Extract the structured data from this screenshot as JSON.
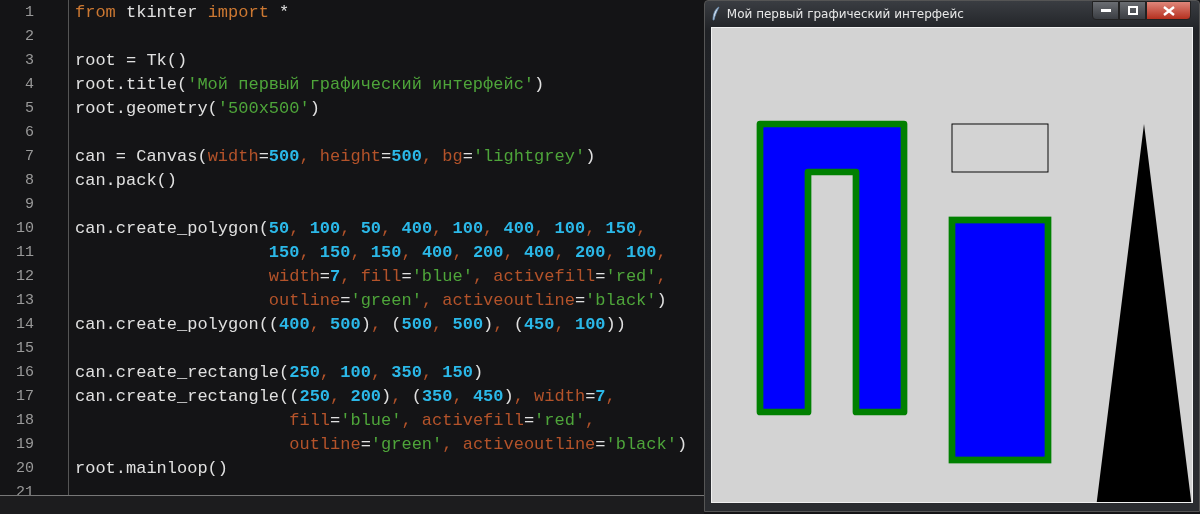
{
  "editor": {
    "lines": [
      {
        "number": "1",
        "tokens": [
          {
            "kind": "k",
            "text": "from"
          },
          {
            "kind": "p",
            "text": " tkinter "
          },
          {
            "kind": "k",
            "text": "import"
          },
          {
            "kind": "p",
            "text": " *"
          }
        ]
      },
      {
        "number": "2"
      },
      {
        "number": "3",
        "tokens": [
          {
            "kind": "p",
            "text": "root = Tk()"
          }
        ]
      },
      {
        "number": "4",
        "tokens": [
          {
            "kind": "p",
            "text": "root.title("
          },
          {
            "kind": "s",
            "text": "'Мой первый графический интерфейс'"
          },
          {
            "kind": "p",
            "text": ")"
          }
        ]
      },
      {
        "number": "5",
        "tokens": [
          {
            "kind": "p",
            "text": "root.geometry("
          },
          {
            "kind": "s",
            "text": "'500x500'"
          },
          {
            "kind": "p",
            "text": ")"
          }
        ]
      },
      {
        "number": "6"
      },
      {
        "number": "7",
        "tokens": [
          {
            "kind": "p",
            "text": "can = Canvas("
          },
          {
            "kind": "a",
            "text": "width"
          },
          {
            "kind": "p",
            "text": "="
          },
          {
            "kind": "n",
            "text": "500"
          },
          {
            "kind": "a",
            "text": ", height"
          },
          {
            "kind": "p",
            "text": "="
          },
          {
            "kind": "n",
            "text": "500"
          },
          {
            "kind": "a",
            "text": ", bg"
          },
          {
            "kind": "p",
            "text": "="
          },
          {
            "kind": "s",
            "text": "'lightgrey'"
          },
          {
            "kind": "p",
            "text": ")"
          }
        ]
      },
      {
        "number": "8",
        "tokens": [
          {
            "kind": "p",
            "text": "can.pack()"
          }
        ]
      },
      {
        "number": "9"
      },
      {
        "number": "10",
        "tokens": [
          {
            "kind": "p",
            "text": "can.create_polygon("
          },
          {
            "kind": "n",
            "text": "50"
          },
          {
            "kind": "a",
            "text": ", "
          },
          {
            "kind": "n",
            "text": "100"
          },
          {
            "kind": "a",
            "text": ", "
          },
          {
            "kind": "n",
            "text": "50"
          },
          {
            "kind": "a",
            "text": ", "
          },
          {
            "kind": "n",
            "text": "400"
          },
          {
            "kind": "a",
            "text": ", "
          },
          {
            "kind": "n",
            "text": "100"
          },
          {
            "kind": "a",
            "text": ", "
          },
          {
            "kind": "n",
            "text": "400"
          },
          {
            "kind": "a",
            "text": ", "
          },
          {
            "kind": "n",
            "text": "100"
          },
          {
            "kind": "a",
            "text": ", "
          },
          {
            "kind": "n",
            "text": "150"
          },
          {
            "kind": "a",
            "text": ","
          }
        ]
      },
      {
        "number": "11",
        "tokens": [
          {
            "kind": "n",
            "text": "                   150"
          },
          {
            "kind": "a",
            "text": ", "
          },
          {
            "kind": "n",
            "text": "150"
          },
          {
            "kind": "a",
            "text": ", "
          },
          {
            "kind": "n",
            "text": "150"
          },
          {
            "kind": "a",
            "text": ", "
          },
          {
            "kind": "n",
            "text": "400"
          },
          {
            "kind": "a",
            "text": ", "
          },
          {
            "kind": "n",
            "text": "200"
          },
          {
            "kind": "a",
            "text": ", "
          },
          {
            "kind": "n",
            "text": "400"
          },
          {
            "kind": "a",
            "text": ", "
          },
          {
            "kind": "n",
            "text": "200"
          },
          {
            "kind": "a",
            "text": ", "
          },
          {
            "kind": "n",
            "text": "100"
          },
          {
            "kind": "a",
            "text": ","
          }
        ]
      },
      {
        "number": "12",
        "tokens": [
          {
            "kind": "a",
            "text": "                   width"
          },
          {
            "kind": "p",
            "text": "="
          },
          {
            "kind": "n",
            "text": "7"
          },
          {
            "kind": "a",
            "text": ", fill"
          },
          {
            "kind": "p",
            "text": "="
          },
          {
            "kind": "s",
            "text": "'blue'"
          },
          {
            "kind": "a",
            "text": ", activefill"
          },
          {
            "kind": "p",
            "text": "="
          },
          {
            "kind": "s",
            "text": "'red'"
          },
          {
            "kind": "a",
            "text": ","
          }
        ]
      },
      {
        "number": "13",
        "tokens": [
          {
            "kind": "a",
            "text": "                   outline"
          },
          {
            "kind": "p",
            "text": "="
          },
          {
            "kind": "s",
            "text": "'green'"
          },
          {
            "kind": "a",
            "text": ", activeoutline"
          },
          {
            "kind": "p",
            "text": "="
          },
          {
            "kind": "s",
            "text": "'black'"
          },
          {
            "kind": "p",
            "text": ")"
          }
        ]
      },
      {
        "number": "14",
        "tokens": [
          {
            "kind": "p",
            "text": "can.create_polygon(("
          },
          {
            "kind": "n",
            "text": "400"
          },
          {
            "kind": "a",
            "text": ", "
          },
          {
            "kind": "n",
            "text": "500"
          },
          {
            "kind": "p",
            "text": ")"
          },
          {
            "kind": "a",
            "text": ", "
          },
          {
            "kind": "p",
            "text": "("
          },
          {
            "kind": "n",
            "text": "500"
          },
          {
            "kind": "a",
            "text": ", "
          },
          {
            "kind": "n",
            "text": "500"
          },
          {
            "kind": "p",
            "text": ")"
          },
          {
            "kind": "a",
            "text": ", "
          },
          {
            "kind": "p",
            "text": "("
          },
          {
            "kind": "n",
            "text": "450"
          },
          {
            "kind": "a",
            "text": ", "
          },
          {
            "kind": "n",
            "text": "100"
          },
          {
            "kind": "p",
            "text": "))"
          }
        ]
      },
      {
        "number": "15"
      },
      {
        "number": "16",
        "tokens": [
          {
            "kind": "p",
            "text": "can.create_rectangle("
          },
          {
            "kind": "n",
            "text": "250"
          },
          {
            "kind": "a",
            "text": ", "
          },
          {
            "kind": "n",
            "text": "100"
          },
          {
            "kind": "a",
            "text": ", "
          },
          {
            "kind": "n",
            "text": "350"
          },
          {
            "kind": "a",
            "text": ", "
          },
          {
            "kind": "n",
            "text": "150"
          },
          {
            "kind": "p",
            "text": ")"
          }
        ]
      },
      {
        "number": "17",
        "tokens": [
          {
            "kind": "p",
            "text": "can.create_rectangle(("
          },
          {
            "kind": "n",
            "text": "250"
          },
          {
            "kind": "a",
            "text": ", "
          },
          {
            "kind": "n",
            "text": "200"
          },
          {
            "kind": "p",
            "text": ")"
          },
          {
            "kind": "a",
            "text": ", "
          },
          {
            "kind": "p",
            "text": "("
          },
          {
            "kind": "n",
            "text": "350"
          },
          {
            "kind": "a",
            "text": ", "
          },
          {
            "kind": "n",
            "text": "450"
          },
          {
            "kind": "p",
            "text": ")"
          },
          {
            "kind": "a",
            "text": ", width"
          },
          {
            "kind": "p",
            "text": "="
          },
          {
            "kind": "n",
            "text": "7"
          },
          {
            "kind": "a",
            "text": ","
          }
        ]
      },
      {
        "number": "18",
        "tokens": [
          {
            "kind": "a",
            "text": "                     fill"
          },
          {
            "kind": "p",
            "text": "="
          },
          {
            "kind": "s",
            "text": "'blue'"
          },
          {
            "kind": "a",
            "text": ", activefill"
          },
          {
            "kind": "p",
            "text": "="
          },
          {
            "kind": "s",
            "text": "'red'"
          },
          {
            "kind": "a",
            "text": ","
          }
        ]
      },
      {
        "number": "19",
        "tokens": [
          {
            "kind": "a",
            "text": "                     outline"
          },
          {
            "kind": "p",
            "text": "="
          },
          {
            "kind": "s",
            "text": "'green'"
          },
          {
            "kind": "a",
            "text": ", activeoutline"
          },
          {
            "kind": "p",
            "text": "="
          },
          {
            "kind": "s",
            "text": "'black'"
          },
          {
            "kind": "p",
            "text": ")"
          }
        ]
      },
      {
        "number": "20",
        "tokens": [
          {
            "kind": "p",
            "text": "root.mainloop()"
          }
        ]
      },
      {
        "number": "21"
      }
    ]
  },
  "window": {
    "title": "Мой первый графический интерфейс"
  }
}
